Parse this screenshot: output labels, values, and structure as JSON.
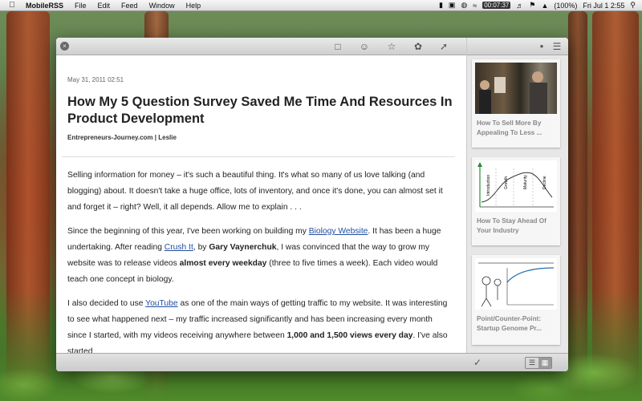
{
  "menubar": {
    "apple_icon": "apple-icon",
    "app_name": "MobileRSS",
    "menus": [
      "File",
      "Edit",
      "Feed",
      "Window",
      "Help"
    ],
    "battery_time": "00:07:37",
    "battery_pct": "(100%)",
    "clock": "Fri Jul 1  2:55",
    "status_icons": [
      "bookmark-icon",
      "display-icon",
      "lock-icon",
      "wifi-icon",
      "volume-icon",
      "flag-icon",
      "bluetooth-icon",
      "search-icon"
    ]
  },
  "toolbar": {
    "icons": [
      "close-icon",
      "window-icon",
      "emoji-icon",
      "star-icon",
      "feed-icon",
      "share-icon",
      "dot-icon",
      "list-icon"
    ]
  },
  "article": {
    "date": "May 31, 2011 02:51",
    "title": "How My 5 Question Survey Saved Me Time And Resources In Product Development",
    "source": "Entrepreneurs-Journey.com | Leslie",
    "p1": "Selling information for money – it's such a beautiful thing. It's what so many of us love talking (and blogging) about. It doesn't take a huge office, lots of inventory, and once it's done, you can almost set it and forget it – right? Well, it all depends. Allow me to explain . . .",
    "p2_a": "Since the beginning of this year, I've been working on building my ",
    "p2_link1": "Biology Website",
    "p2_b": ". It has been a huge undertaking. After reading ",
    "p2_link2": "Crush It",
    "p2_c": ", by ",
    "p2_bold1": "Gary Vaynerchuk",
    "p2_d": ", I was convinced that the way to grow my website was to release videos ",
    "p2_bold2": "almost every weekday",
    "p2_e": " (three to five times a week). Each video would teach one concept in biology.",
    "p3_a": "I also decided to use ",
    "p3_link": "YouTube",
    "p3_b": " as one of the main ways of getting traffic to my website. It was interesting to see what happened next – my traffic increased significantly and has been increasing every month since I started, with my videos receiving anywhere between ",
    "p3_bold": "1,000 and 1,500 views every day",
    "p3_c": ". I've also started"
  },
  "sidebar": {
    "cards": [
      {
        "title": "How To Sell More By Appealing To Less ..."
      },
      {
        "title": "How To Stay Ahead Of Your Industry"
      },
      {
        "title": "Point/Counter-Point: Startup Genome Pr..."
      }
    ],
    "chart_labels": [
      "Introduction",
      "Growth",
      "Maturity",
      "Decline"
    ]
  },
  "bottombar": {
    "check_icon": "checkmark-icon",
    "view_list_icon": "list-view-icon",
    "view_grid_icon": "grid-view-icon"
  }
}
